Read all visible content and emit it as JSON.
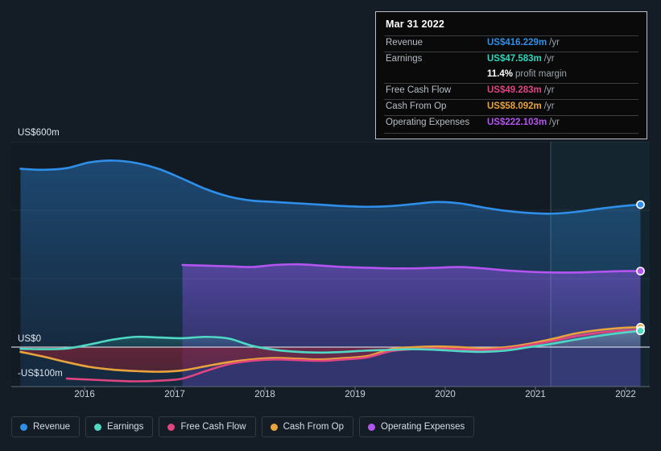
{
  "axis": {
    "y_labels": [
      {
        "text": "US$600m",
        "value": 600
      },
      {
        "text": "US$0",
        "value": 0
      },
      {
        "text": "-US$100m",
        "value": -100
      }
    ],
    "x_labels": [
      "2016",
      "2017",
      "2018",
      "2019",
      "2020",
      "2021",
      "2022"
    ]
  },
  "tooltip": {
    "title": "Mar 31 2022",
    "rows": [
      {
        "label": "Revenue",
        "value": "US$416.229m",
        "unit": "/yr",
        "color": "#2f8fe8"
      },
      {
        "label": "Earnings",
        "value": "US$47.583m",
        "unit": "/yr",
        "color": "#2fd8bb"
      },
      {
        "label": "Free Cash Flow",
        "value": "US$49.283m",
        "unit": "/yr",
        "color": "#e0457f"
      },
      {
        "label": "Cash From Op",
        "value": "US$58.092m",
        "unit": "/yr",
        "color": "#e8a33c"
      },
      {
        "label": "Operating Expenses",
        "value": "US$222.103m",
        "unit": "/yr",
        "color": "#b455f0"
      }
    ],
    "margin_value": "11.4%",
    "margin_label": "profit margin"
  },
  "legend": {
    "items": [
      {
        "label": "Revenue",
        "color": "#2f8fe8"
      },
      {
        "label": "Earnings",
        "color": "#4fd8c4"
      },
      {
        "label": "Free Cash Flow",
        "color": "#e0457f"
      },
      {
        "label": "Cash From Op",
        "color": "#e8a33c"
      },
      {
        "label": "Operating Expenses",
        "color": "#b455f0"
      }
    ]
  },
  "chart_data": {
    "type": "area",
    "title": "",
    "xlabel": "",
    "ylabel": "",
    "ylim": [
      -130,
      600
    ],
    "xlim": [
      2015.45,
      2022.35
    ],
    "grid": true,
    "legend_position": "bottom",
    "currency": "US$",
    "units": "millions",
    "forecast_start": 2021.28,
    "zero_line": 0,
    "x": [
      2015.55,
      2015.8,
      2016.05,
      2016.3,
      2016.55,
      2016.8,
      2017.05,
      2017.3,
      2017.55,
      2017.8,
      2018.05,
      2018.3,
      2018.55,
      2018.8,
      2019.05,
      2019.3,
      2019.55,
      2019.8,
      2020.05,
      2020.3,
      2020.55,
      2020.8,
      2021.05,
      2021.3,
      2021.55,
      2021.8,
      2022.05,
      2022.25
    ],
    "series": [
      {
        "name": "Revenue",
        "color": "#2f8fe8",
        "values": [
          521,
          518,
          523,
          540,
          545,
          538,
          520,
          492,
          462,
          440,
          428,
          424,
          420,
          416,
          412,
          410,
          412,
          418,
          424,
          420,
          408,
          398,
          392,
          390,
          395,
          404,
          412,
          416.229
        ]
      },
      {
        "name": "Earnings",
        "color": "#4fd8c4",
        "values": [
          -5,
          -6,
          -4,
          8,
          22,
          30,
          28,
          26,
          30,
          25,
          4,
          -8,
          -14,
          -16,
          -14,
          -10,
          -8,
          -6,
          -8,
          -12,
          -14,
          -10,
          0,
          10,
          22,
          33,
          42,
          47.583
        ]
      },
      {
        "name": "Free Cash Flow",
        "color": "#e0457f",
        "values": [
          null,
          null,
          -92,
          -95,
          -98,
          -100,
          -98,
          -92,
          -70,
          -50,
          -40,
          -36,
          -38,
          -40,
          -36,
          -30,
          -12,
          -6,
          -4,
          -6,
          -8,
          -4,
          6,
          18,
          32,
          42,
          48,
          49.283
        ]
      },
      {
        "name": "Cash From Op",
        "color": "#e8a33c",
        "values": [
          -14,
          -28,
          -44,
          -58,
          -66,
          -70,
          -72,
          -68,
          -56,
          -44,
          -36,
          -32,
          -34,
          -36,
          -32,
          -26,
          -6,
          0,
          2,
          0,
          -4,
          0,
          10,
          24,
          40,
          50,
          56,
          58.092
        ]
      },
      {
        "name": "Operating Expenses",
        "color": "#b455f0",
        "values": [
          null,
          null,
          null,
          null,
          null,
          null,
          null,
          240,
          238,
          236,
          234,
          240,
          242,
          238,
          234,
          232,
          230,
          230,
          232,
          234,
          230,
          224,
          220,
          218,
          218,
          220,
          222,
          222.103
        ]
      }
    ]
  }
}
